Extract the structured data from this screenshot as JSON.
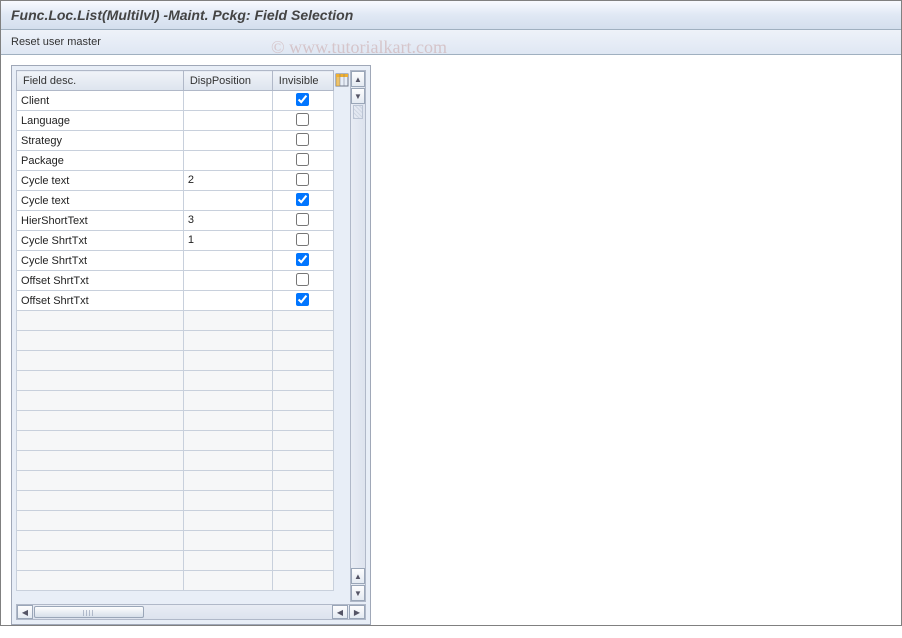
{
  "header": {
    "title": "Func.Loc.List(Multilvl) -Maint. Pckg: Field Selection"
  },
  "toolbar": {
    "reset_label": "Reset user master"
  },
  "watermark": "© www.tutorialkart.com",
  "table": {
    "columns": {
      "field": "Field desc.",
      "position": "DispPosition",
      "invisible": "Invisible"
    },
    "rows": [
      {
        "field": "Client",
        "position": "",
        "invisible": true
      },
      {
        "field": "Language",
        "position": "",
        "invisible": false
      },
      {
        "field": "Strategy",
        "position": "",
        "invisible": false
      },
      {
        "field": "Package",
        "position": "",
        "invisible": false
      },
      {
        "field": "Cycle text",
        "position": "2",
        "invisible": false
      },
      {
        "field": "Cycle text",
        "position": "",
        "invisible": true
      },
      {
        "field": "HierShortText",
        "position": "3",
        "invisible": false
      },
      {
        "field": "Cycle ShrtTxt",
        "position": "1",
        "invisible": false
      },
      {
        "field": "Cycle ShrtTxt",
        "position": "",
        "invisible": true
      },
      {
        "field": "Offset ShrtTxt",
        "position": "",
        "invisible": false
      },
      {
        "field": "Offset ShrtTxt",
        "position": "",
        "invisible": true
      }
    ],
    "empty_row_count": 14
  }
}
